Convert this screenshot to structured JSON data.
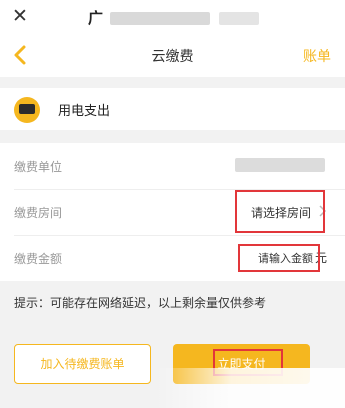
{
  "app": {
    "title_visible_char": "广"
  },
  "nav": {
    "back_icon": "chevron-left-icon",
    "title": "云缴费",
    "right_link": "账单"
  },
  "category": {
    "icon": "electricity-icon",
    "label": "用电支出"
  },
  "form": {
    "unit_label": "缴费单位",
    "room_label": "缴费房间",
    "room_value": "请选择房间",
    "amount_label": "缴费金额",
    "amount_placeholder": "请输入金额",
    "amount_unit": "元"
  },
  "hint": "提示：可能存在网络延迟，以上剩余量仅供参考",
  "buttons": {
    "add_bill": "加入待缴费账单",
    "pay_now": "立即支付"
  },
  "colors": {
    "accent": "#f5b71f",
    "highlight_box": "#e2363a"
  }
}
